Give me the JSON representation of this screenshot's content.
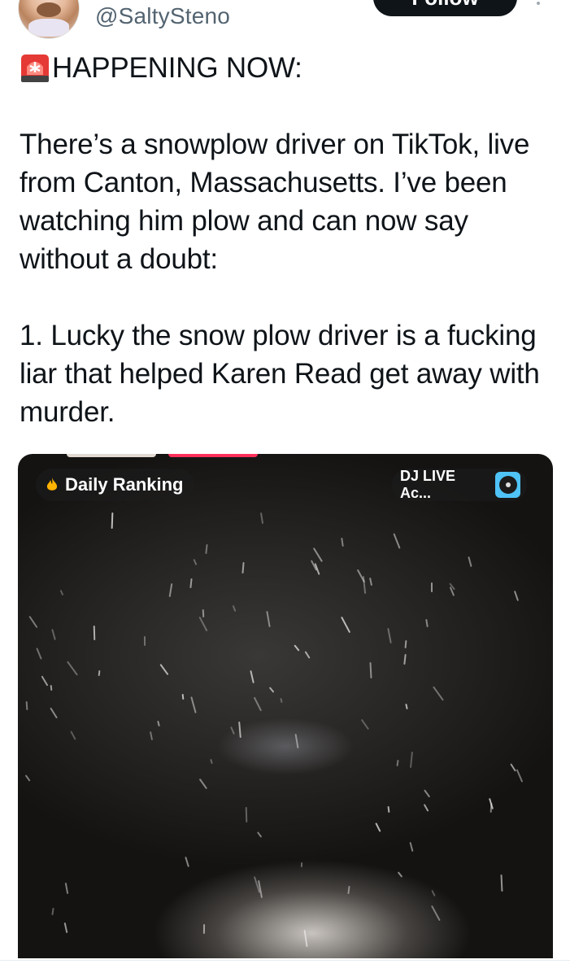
{
  "author": {
    "handle": "@SaltySteno"
  },
  "follow_button": {
    "label": "Follow"
  },
  "more_icon": "more-dots-icon",
  "tweet": {
    "headline": "HAPPENING NOW:",
    "headline_icon": "siren-icon",
    "paragraph_1": "There’s a snowplow driver on TikTok, live from Canton, Massachusetts. I’ve been watching him plow and can now say without a doubt:",
    "paragraph_2": "1. Lucky the snow plow driver is a fucking liar that helped Karen Read get away with murder."
  },
  "media": {
    "daily_ranking_label": "Daily Ranking",
    "daily_ranking_icon": "flame-icon",
    "dj_live_label": "DJ LIVE Ac...",
    "dj_live_icon": "music-disc-icon"
  },
  "colors": {
    "text": "#0f1419",
    "secondary_text": "#536471",
    "follow_bg": "#0f1419",
    "live_badge": "#ff2f5a"
  }
}
